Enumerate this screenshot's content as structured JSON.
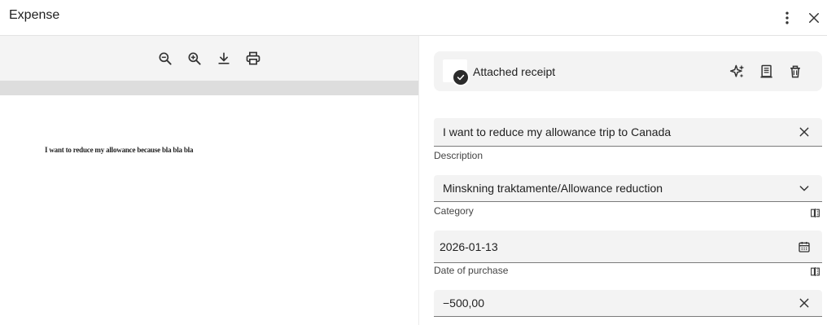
{
  "header": {
    "title": "Expense",
    "more_icon": "more-vert-icon",
    "close_icon": "close-icon"
  },
  "viewer": {
    "toolbar": [
      "zoom-out-icon",
      "zoom-in-icon",
      "download-icon",
      "print-icon"
    ],
    "document_text": "I want to reduce my allowance because bla bla bla"
  },
  "receipt": {
    "label": "Attached receipt",
    "actions": [
      "ai-sparkle-icon",
      "receipt-icon",
      "delete-icon"
    ]
  },
  "fields": {
    "description": {
      "value": "I want to reduce my allowance trip to Canada",
      "label": "Description"
    },
    "category": {
      "value": "Minskning traktamente/Allowance reduction",
      "label": "Category"
    },
    "date": {
      "value": "2026-01-13",
      "label": "Date of purchase"
    },
    "amount": {
      "value": "−500,00"
    }
  },
  "colors": {
    "field_bg": "#f3f3f3",
    "toolbar_bg": "#f4f4f4",
    "check_badge": "#2b2b2b"
  }
}
